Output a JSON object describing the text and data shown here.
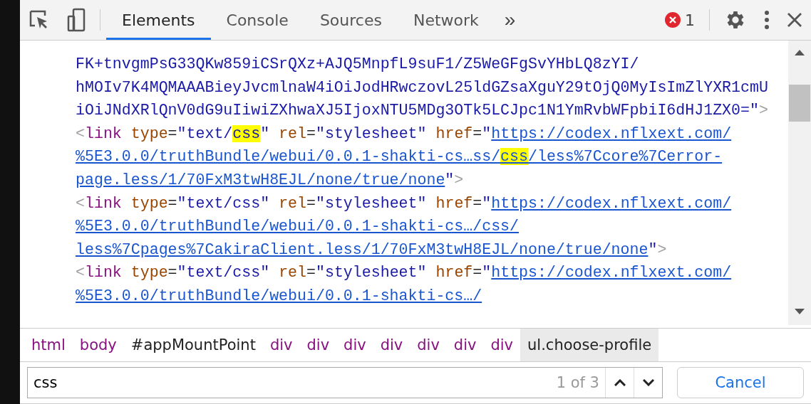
{
  "toolbar": {
    "tabs": [
      {
        "label": "Elements",
        "selected": true
      },
      {
        "label": "Console",
        "selected": false
      },
      {
        "label": "Sources",
        "selected": false
      },
      {
        "label": "Network",
        "selected": false
      }
    ],
    "overflow": "»",
    "error_count": "1"
  },
  "code_lines": [
    {
      "segments": [
        {
          "kind": "value",
          "text": "FK+tnvgmPsG33QKw859iCSrQXz+AJQ5MnpfL9suF1/Z5WeGFgSvYHbLQ8zYI/"
        }
      ]
    },
    {
      "segments": [
        {
          "kind": "value",
          "text": "hMOIv7K4MQMAAABieyJvcmlnaW4iOiJodHRwczovL25ldGZsaXguY29tOjQ0MyIsImZlYXR1cmU"
        }
      ]
    },
    {
      "segments": [
        {
          "kind": "value",
          "text": "iOiJNdXRlQnV0dG9uIiwiZXhwaXJ5IjoxNTU5MDg3OTk5LCJpc1N1YmRvbWFpbiI6dHJ1ZX0=\""
        },
        {
          "kind": "punct",
          "text": ">"
        }
      ]
    },
    {
      "segments": [
        {
          "kind": "punct",
          "text": "<"
        },
        {
          "kind": "tag",
          "text": "link"
        },
        {
          "kind": "attr",
          "text": " type"
        },
        {
          "kind": "plain",
          "text": "="
        },
        {
          "kind": "value",
          "text": "\"text/"
        },
        {
          "kind": "value",
          "text": "css",
          "match": true
        },
        {
          "kind": "value",
          "text": "\""
        },
        {
          "kind": "attr",
          "text": " rel"
        },
        {
          "kind": "plain",
          "text": "="
        },
        {
          "kind": "value",
          "text": "\"stylesheet\""
        },
        {
          "kind": "attr",
          "text": " href"
        },
        {
          "kind": "plain",
          "text": "="
        },
        {
          "kind": "value",
          "text": "\""
        },
        {
          "kind": "link",
          "text": "https://codex.nflxext.com/"
        }
      ]
    },
    {
      "segments": [
        {
          "kind": "link",
          "text": "%5E3.0.0/truthBundle/webui/0.0.1-shakti-cs…ss/"
        },
        {
          "kind": "link",
          "text": "css",
          "match": true
        },
        {
          "kind": "link",
          "text": "/less%7Ccore%7Cerror-"
        }
      ]
    },
    {
      "segments": [
        {
          "kind": "link",
          "text": "page.less/1/70FxM3twH8EJL/none/true/none"
        },
        {
          "kind": "value",
          "text": "\""
        },
        {
          "kind": "punct",
          "text": ">"
        }
      ]
    },
    {
      "segments": [
        {
          "kind": "punct",
          "text": "<"
        },
        {
          "kind": "tag",
          "text": "link"
        },
        {
          "kind": "attr",
          "text": " type"
        },
        {
          "kind": "plain",
          "text": "="
        },
        {
          "kind": "value",
          "text": "\"text/css\""
        },
        {
          "kind": "attr",
          "text": " rel"
        },
        {
          "kind": "plain",
          "text": "="
        },
        {
          "kind": "value",
          "text": "\"stylesheet\""
        },
        {
          "kind": "attr",
          "text": " href"
        },
        {
          "kind": "plain",
          "text": "="
        },
        {
          "kind": "value",
          "text": "\""
        },
        {
          "kind": "link",
          "text": "https://codex.nflxext.com/"
        }
      ]
    },
    {
      "segments": [
        {
          "kind": "link",
          "text": "%5E3.0.0/truthBundle/webui/0.0.1-shakti-cs…/css/"
        }
      ]
    },
    {
      "segments": [
        {
          "kind": "link",
          "text": "less%7Cpages%7CakiraClient.less/1/70FxM3twH8EJL/none/true/none"
        },
        {
          "kind": "value",
          "text": "\""
        },
        {
          "kind": "punct",
          "text": ">"
        }
      ]
    },
    {
      "segments": [
        {
          "kind": "punct",
          "text": "<"
        },
        {
          "kind": "tag",
          "text": "link"
        },
        {
          "kind": "attr",
          "text": " type"
        },
        {
          "kind": "plain",
          "text": "="
        },
        {
          "kind": "value",
          "text": "\"text/css\""
        },
        {
          "kind": "attr",
          "text": " rel"
        },
        {
          "kind": "plain",
          "text": "="
        },
        {
          "kind": "value",
          "text": "\"stylesheet\""
        },
        {
          "kind": "attr",
          "text": " href"
        },
        {
          "kind": "plain",
          "text": "="
        },
        {
          "kind": "value",
          "text": "\""
        },
        {
          "kind": "link",
          "text": "https://codex.nflxext.com/"
        }
      ]
    },
    {
      "segments": [
        {
          "kind": "link",
          "text": "%5E3.0.0/truthBundle/webui/0.0.1-shakti-cs…/"
        }
      ]
    }
  ],
  "breadcrumbs": [
    {
      "kind": "tag",
      "label": "html",
      "selected": false
    },
    {
      "kind": "tag",
      "label": "body",
      "selected": false
    },
    {
      "kind": "id",
      "label": "#appMountPoint",
      "selected": false
    },
    {
      "kind": "tag",
      "label": "div",
      "selected": false
    },
    {
      "kind": "tag",
      "label": "div",
      "selected": false
    },
    {
      "kind": "tag",
      "label": "div",
      "selected": false
    },
    {
      "kind": "tag",
      "label": "div",
      "selected": false
    },
    {
      "kind": "tag",
      "label": "div",
      "selected": false
    },
    {
      "kind": "tag",
      "label": "div",
      "selected": false
    },
    {
      "kind": "tag",
      "label": "div",
      "selected": false
    },
    {
      "kind": "class",
      "label": "ul.choose-profile",
      "selected": true
    }
  ],
  "search": {
    "value": "css",
    "match_count": "1 of 3",
    "cancel": "Cancel"
  }
}
